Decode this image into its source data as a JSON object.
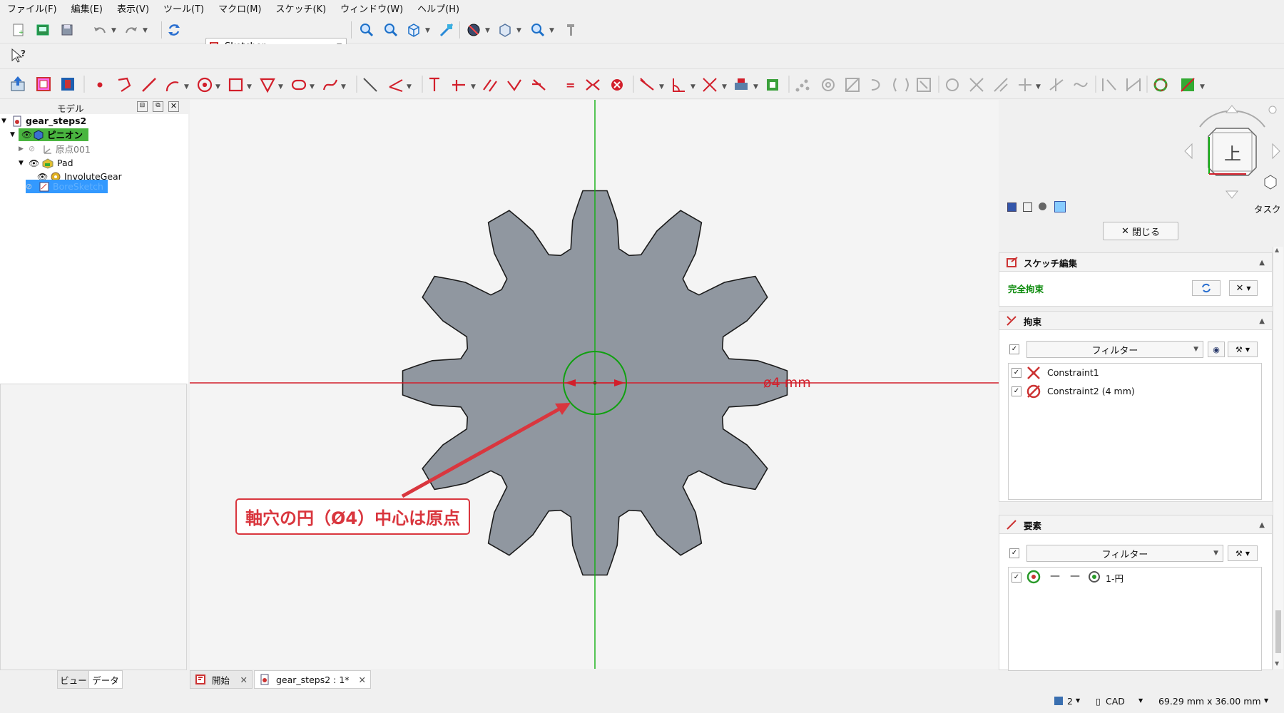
{
  "menu": [
    "ファイル(F)",
    "編集(E)",
    "表示(V)",
    "ツール(T)",
    "マクロ(M)",
    "スケッチ(K)",
    "ウィンドウ(W)",
    "ヘルプ(H)"
  ],
  "workbench": {
    "selected": "Sketcher"
  },
  "model_panel": {
    "title": "モデル",
    "tree": [
      {
        "label": "gear_steps2",
        "depth": 0,
        "bold": true
      },
      {
        "label": "ピニオン",
        "depth": 1,
        "bold": true,
        "highlight": "green"
      },
      {
        "label": "原点001",
        "depth": 2,
        "dim": true
      },
      {
        "label": "Pad",
        "depth": 2
      },
      {
        "label": "InvoluteGear",
        "depth": 3
      },
      {
        "label": "BoreSketch",
        "depth": 2,
        "highlight": "blue"
      }
    ]
  },
  "left_tabs": [
    "ビュー",
    "データ"
  ],
  "viewport": {
    "dimension_text": "ø4 mm",
    "annotation": "軸穴の円（Ø4）中心は原点",
    "navcube_face": "上"
  },
  "task_panel": {
    "title": "タスク",
    "close_button": "閉じる",
    "sketch_edit": {
      "title": "スケッチ編集",
      "status": "完全拘束"
    },
    "constraints": {
      "title": "拘束",
      "filter": "フィルター",
      "items": [
        "Constraint1",
        "Constraint2 (4 mm)"
      ]
    },
    "elements": {
      "title": "要素",
      "filter": "フィルター",
      "items": [
        "1-円"
      ]
    }
  },
  "doc_tabs": [
    "開始",
    "gear_steps2 : 1*"
  ],
  "status": {
    "page": "2",
    "nav": "CAD",
    "size": "69.29 mm x 36.00 mm"
  },
  "colors": {
    "accent_red": "#d9363e",
    "green_axis": "#00aa00",
    "gear_fill": "#9097a0",
    "select_blue": "#3399ff"
  }
}
